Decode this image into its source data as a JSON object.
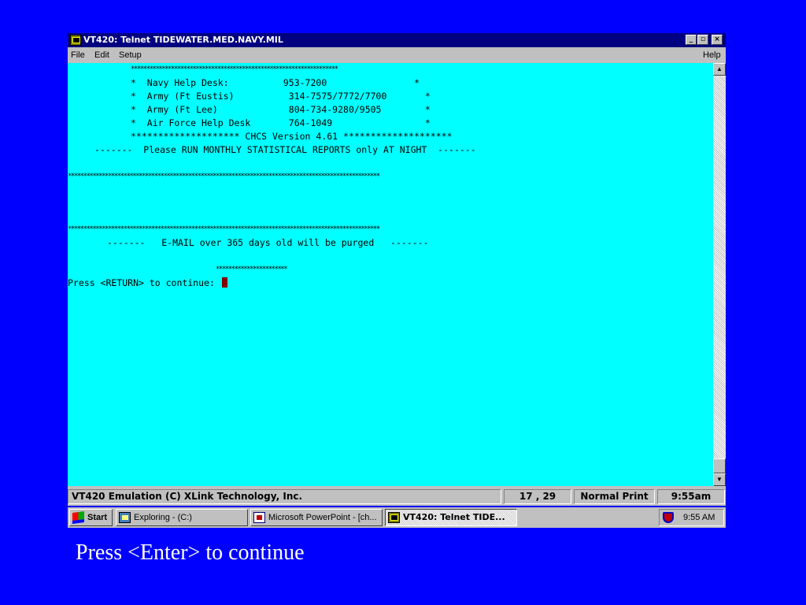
{
  "window": {
    "title": "VT420: Telnet TIDEWATER.MED.NAVY.MIL",
    "controls": {
      "minimize": "_",
      "maximize": "▫",
      "close": "×"
    }
  },
  "menubar": {
    "file": "File",
    "edit": "Edit",
    "setup": "Setup",
    "help": "Help"
  },
  "terminal": {
    "lines": [
      "*******************************************************************",
      "*  Navy Help Desk:          953-7200                *",
      "*  Army (Ft Eustis)          314-7575/7772/7700       *",
      "*  Army (Ft Lee)             804-734-9280/9505        *",
      "*  Air Force Help Desk       764-1049                 *",
      "******************** CHCS Version 4.61 ********************",
      "-------  Please RUN MONTHLY STATISTICAL REPORTS only AT NIGHT  -------",
      "*****************************************************************************************************",
      "*****************************************************************************************************",
      "-------   E-MAIL over 365 days old will be purged   -------",
      "***********************",
      "Press <RETURN> to continue: "
    ]
  },
  "statusbar": {
    "emulation": "VT420 Emulation (C) XLink Technology, Inc.",
    "position": "17 , 29",
    "print_mode": "Normal Print",
    "time": "9:55am"
  },
  "taskbar": {
    "start": "Start",
    "tasks": [
      "Exploring - (C:)",
      "Microsoft PowerPoint - [ch...",
      "VT420: Telnet TIDE..."
    ],
    "clock": "9:55 AM"
  },
  "caption": "Press <Enter> to continue"
}
